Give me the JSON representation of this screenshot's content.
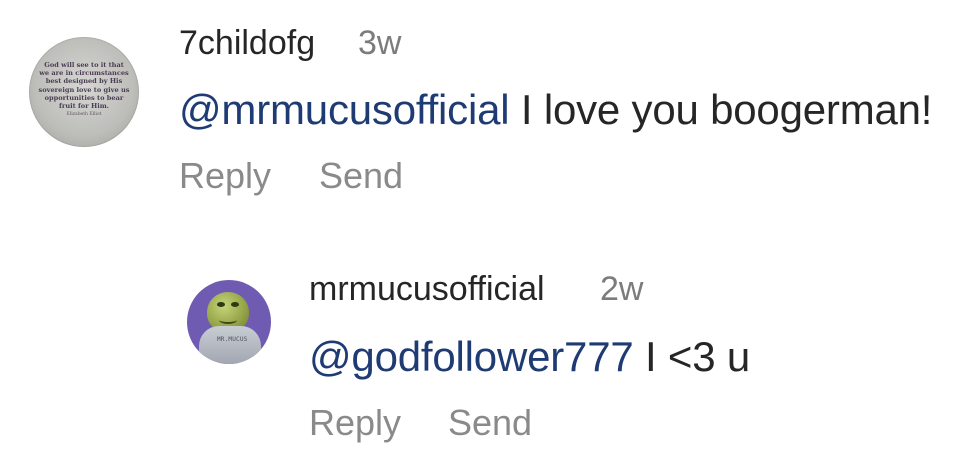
{
  "comments": [
    {
      "username": "7childofg",
      "time": "3w",
      "mention": "@mrmucusofficial",
      "text": " I love you boogerman!",
      "reply_label": "Reply",
      "send_label": "Send",
      "avatar_quote": [
        "God will see to it that",
        "we are in circumstances",
        "best designed by His",
        "sovereign love to give us",
        "opportunities to bear",
        "fruit for Him."
      ],
      "avatar_signature": "Elizabeth Elliot",
      "avatar_icon": "quote-avatar"
    },
    {
      "username": "mrmucusofficial",
      "time": "2w",
      "mention": "@godfollower777",
      "text": " I <3 u",
      "reply_label": "Reply",
      "send_label": "Send",
      "avatar_shirt_text": "MR.MUCUS",
      "avatar_icon": "character-avatar"
    }
  ],
  "colors": {
    "username": "#262626",
    "time": "#7c7c7c",
    "mention": "#1f3b73",
    "action": "#8a8a8a",
    "avatar2_bg": "#6f5bb2"
  }
}
